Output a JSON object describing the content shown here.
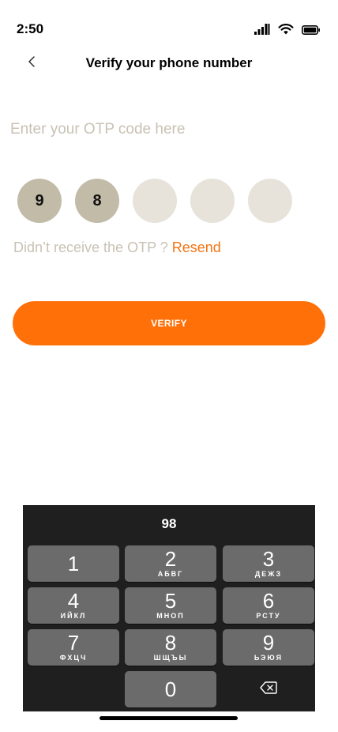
{
  "status_bar": {
    "time": "2:50",
    "icons": [
      "cellular-signal-icon",
      "wifi-icon",
      "battery-icon"
    ]
  },
  "header": {
    "back_icon": "chevron-left-icon",
    "title": "Verify your phone number"
  },
  "otp": {
    "prompt": "Enter your OTP code here",
    "digits": [
      "9",
      "8",
      "",
      "",
      ""
    ],
    "resend_prompt": "Didn’t receive the OTP ? ",
    "resend_link": "Resend"
  },
  "verify_button": {
    "label": "VERIFY"
  },
  "keyboard": {
    "display": "98",
    "keys": [
      {
        "num": "1",
        "letters": ""
      },
      {
        "num": "2",
        "letters": "АБВГ"
      },
      {
        "num": "3",
        "letters": "ДЕЖЗ"
      },
      {
        "num": "4",
        "letters": "ИЙКЛ"
      },
      {
        "num": "5",
        "letters": "МНОП"
      },
      {
        "num": "6",
        "letters": "РСТУ"
      },
      {
        "num": "7",
        "letters": "ФХЦЧ"
      },
      {
        "num": "8",
        "letters": "ШЩЪЫ"
      },
      {
        "num": "9",
        "letters": "ЬЭЮЯ"
      },
      {
        "num": "0",
        "letters": ""
      }
    ],
    "delete_icon": "backspace-icon"
  },
  "colors": {
    "accent": "#ff7009",
    "digit_filled": "#c2bba8",
    "digit_empty": "#e7e3da",
    "muted_text": "#c9c2b4",
    "keyboard_bg": "#1f1f1f",
    "key_bg": "#6b6b6b"
  }
}
